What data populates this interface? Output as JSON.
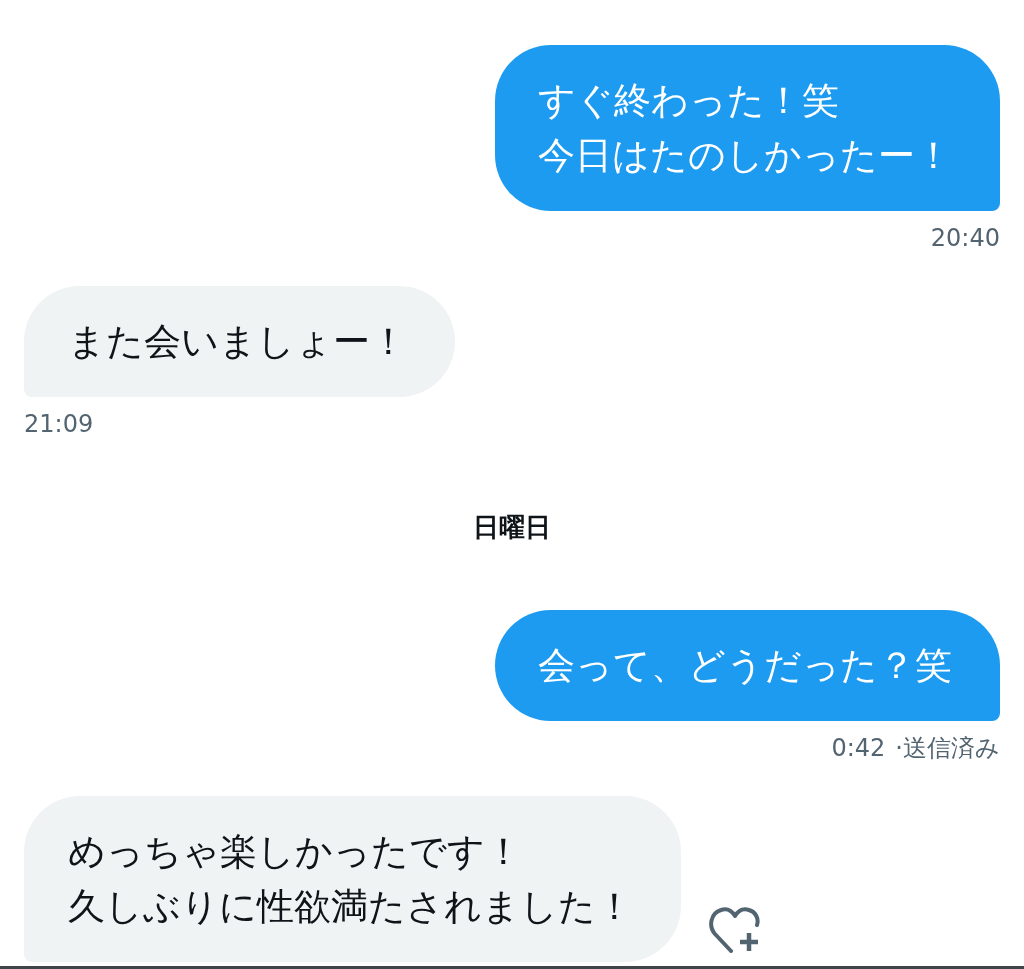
{
  "conversation": [
    {
      "kind": "sent_message",
      "lines": [
        "すぐ終わった！笑",
        "今日はたのしかったー！"
      ],
      "time": "20:40",
      "reaction_button": false
    },
    {
      "kind": "received_message",
      "lines": [
        "また会いましょー！"
      ],
      "time": "21:09",
      "reaction_button": false
    },
    {
      "kind": "day_separator",
      "label": "日曜日"
    },
    {
      "kind": "sent_message",
      "lines": [
        "会って、どうだった？笑"
      ],
      "time": "0:42",
      "status": "·送信済み",
      "reaction_button": false
    },
    {
      "kind": "received_message",
      "lines": [
        "めっちゃ楽しかったです！",
        "久しぶりに性欲満たされました！"
      ],
      "reaction_button": true
    }
  ]
}
